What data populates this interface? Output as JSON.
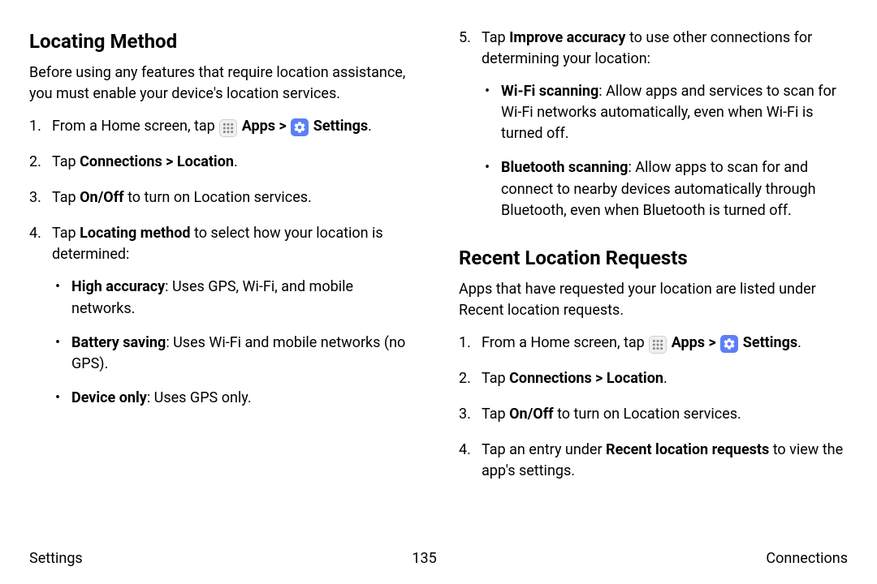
{
  "footer": {
    "left": "Settings",
    "page": "135",
    "right": "Connections"
  },
  "section1": {
    "title": "Locating Method",
    "intro": "Before using any features that require location assistance, you must enable your device's location services.",
    "step1_a": "From a Home screen, tap ",
    "apps_label": "Apps",
    "sep": " > ",
    "settings_label": "Settings",
    "period": ".",
    "step2_a": "Tap ",
    "step2_b": "Connections > Location",
    "step3_a": "Tap ",
    "step3_b": "On/Off",
    "step3_c": " to turn on Location services.",
    "step4_a": "Tap ",
    "step4_b": "Locating method",
    "step4_c": " to select how your location is determined:",
    "b1_a": "High accuracy",
    "b1_b": ": Uses GPS, Wi-Fi, and mobile networks.",
    "b2_a": "Battery saving",
    "b2_b": ": Uses Wi-Fi and mobile networks (no GPS).",
    "b3_a": "Device only",
    "b3_b": ": Uses GPS only."
  },
  "section1b": {
    "step5_a": "Tap ",
    "step5_b": "Improve accuracy",
    "step5_c": " to use other connections for determining your location:",
    "c1_a": "Wi-Fi scanning",
    "c1_b": ": Allow apps and services to scan for Wi-Fi networks automatically, even when Wi-Fi is turned off.",
    "c2_a": "Bluetooth scanning",
    "c2_b": ": Allow apps to scan for and connect to nearby devices automatically through Bluetooth, even when Bluetooth is turned off."
  },
  "section2": {
    "title": "Recent Location Requests",
    "intro": "Apps that have requested your location are listed under Recent location requests.",
    "step1_a": "From a Home screen, tap ",
    "apps_label": "Apps",
    "sep": " > ",
    "settings_label": "Settings",
    "period": ".",
    "step2_a": "Tap ",
    "step2_b": "Connections > Location",
    "step3_a": "Tap ",
    "step3_b": "On/Off",
    "step3_c": " to turn on Location services.",
    "step4_a": "Tap an entry under ",
    "step4_b": "Recent location requests",
    "step4_c": " to view the app's settings."
  }
}
